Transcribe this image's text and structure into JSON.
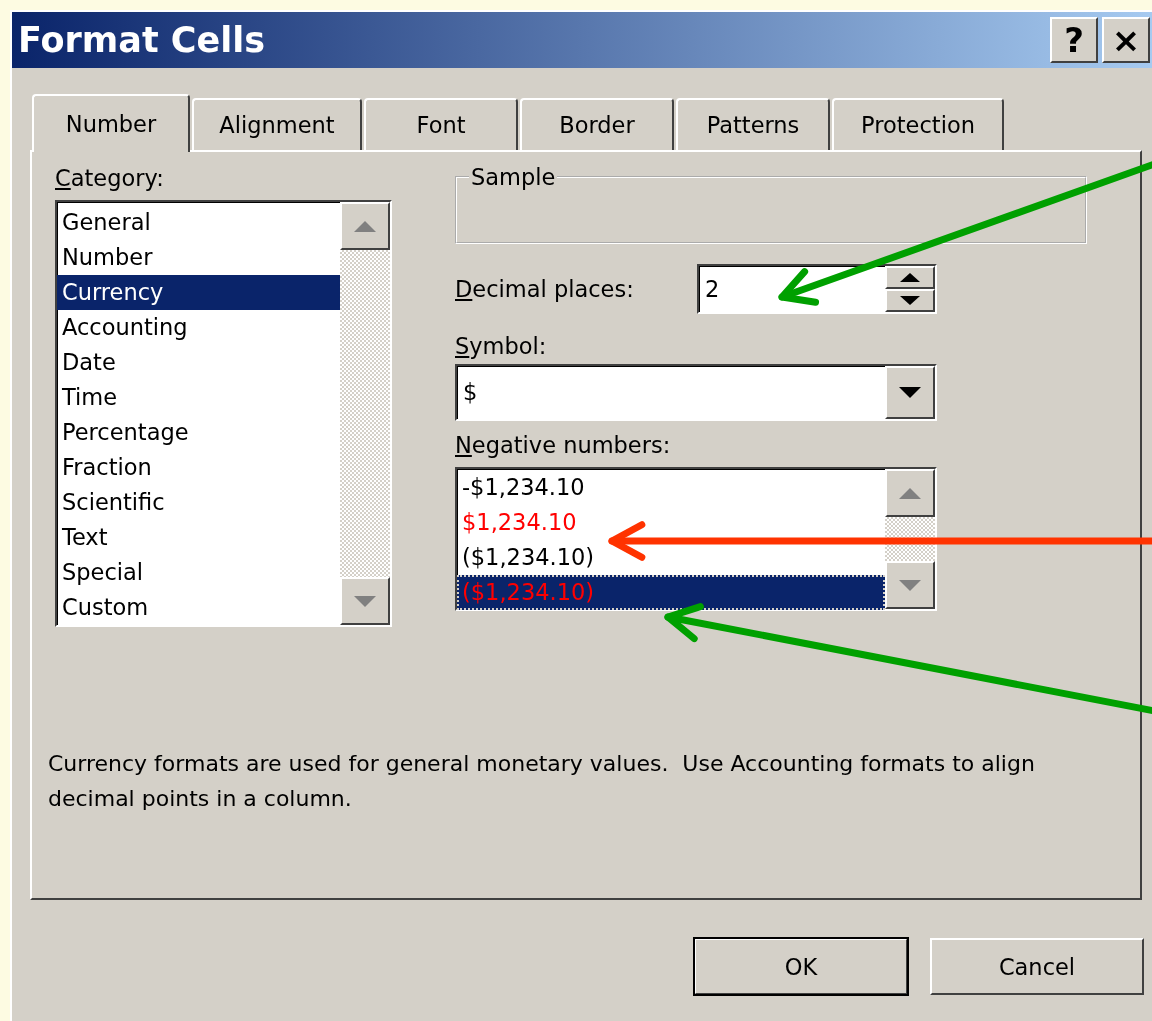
{
  "window": {
    "title": "Format Cells",
    "title_buttons": [
      "?",
      "×"
    ]
  },
  "tabs": [
    {
      "label": "Number",
      "selected": true
    },
    {
      "label": "Alignment",
      "selected": false
    },
    {
      "label": "Font",
      "selected": false
    },
    {
      "label": "Border",
      "selected": false
    },
    {
      "label": "Patterns",
      "selected": false
    },
    {
      "label": "Protection",
      "selected": false
    }
  ],
  "category": {
    "label": "Category:",
    "items": [
      {
        "label": "General",
        "selected": false
      },
      {
        "label": "Number",
        "selected": false
      },
      {
        "label": "Currency",
        "selected": true
      },
      {
        "label": "Accounting",
        "selected": false
      },
      {
        "label": "Date",
        "selected": false
      },
      {
        "label": "Time",
        "selected": false
      },
      {
        "label": "Percentage",
        "selected": false
      },
      {
        "label": "Fraction",
        "selected": false
      },
      {
        "label": "Scientific",
        "selected": false
      },
      {
        "label": "Text",
        "selected": false
      },
      {
        "label": "Special",
        "selected": false
      },
      {
        "label": "Custom",
        "selected": false
      }
    ]
  },
  "sample": {
    "label": "Sample"
  },
  "decimal_places": {
    "label": "Decimal places:",
    "value": "2"
  },
  "symbol": {
    "label": "Symbol:",
    "value": "$"
  },
  "negative_numbers": {
    "label": "Negative numbers:",
    "items": [
      {
        "label": "-$1,234.10",
        "color": "#000000",
        "selected": false
      },
      {
        "label": "$1,234.10",
        "color": "#ff0000",
        "selected": false
      },
      {
        "label": "($1,234.10)",
        "color": "#000000",
        "selected": false
      },
      {
        "label": "($1,234.10)",
        "color": "#ff0000",
        "selected": true
      }
    ]
  },
  "description": "Currency formats are used for general monetary values.  Use Accounting formats to align decimal points in a column.",
  "buttons": [
    {
      "label": "OK",
      "default": true
    },
    {
      "label": "Cancel",
      "default": false
    }
  ],
  "annotations": [
    {
      "color": "#00a000"
    },
    {
      "color": "#ff3300"
    },
    {
      "color": "#00a000"
    }
  ]
}
